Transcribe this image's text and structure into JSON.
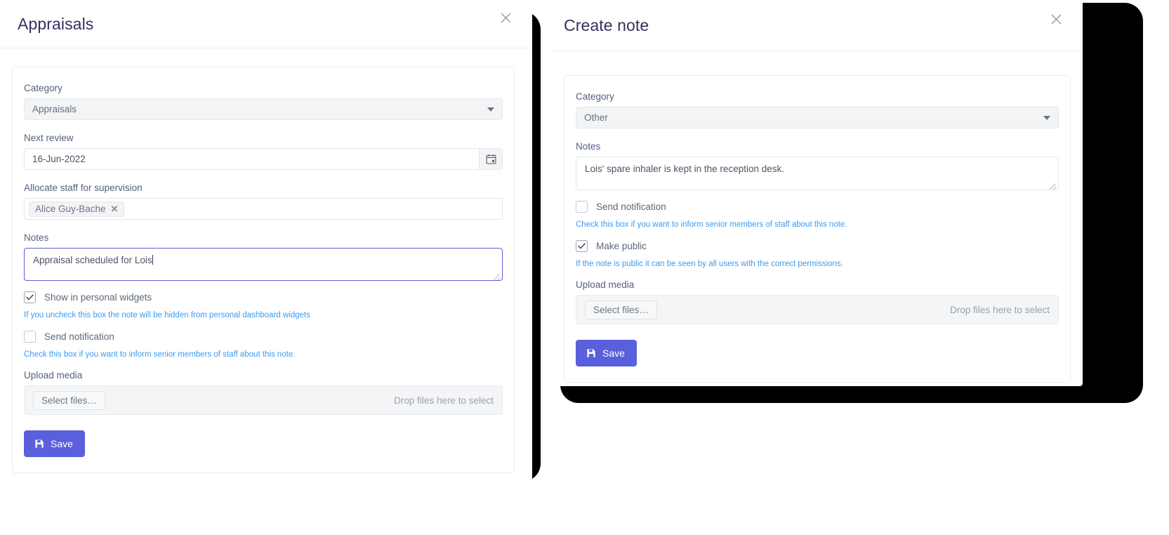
{
  "theme": {
    "accent": "#5a5fdc",
    "help_link": "#3b9bf0",
    "title_color": "#32325d",
    "label_color": "#525f7f",
    "shadow_plate": "#000000",
    "focus_border": "#5e60ce"
  },
  "left_dialog": {
    "title": "Appraisals",
    "close_icon": "close-icon",
    "fields": {
      "category_label": "Category",
      "category_value": "Appraisals",
      "next_review_label": "Next review",
      "next_review_value": "16-Jun-2022",
      "date_picker_icon": "calendar-icon",
      "allocate_label": "Allocate staff for supervision",
      "allocate_token": "Alice Guy-Bache",
      "allocate_token_remove": "✕",
      "notes_label": "Notes",
      "notes_value": "Appraisal scheduled for Lois"
    },
    "checkboxes": [
      {
        "label": "Show in personal widgets",
        "checked": true,
        "help": "If you uncheck this box the note will be hidden from personal dashboard widgets"
      },
      {
        "label": "Send notification",
        "checked": false,
        "help": "Check this box if you want to inform senior members of staff about this note."
      }
    ],
    "upload": {
      "label": "Upload media",
      "button": "Select files…",
      "hint": "Drop files here to select"
    },
    "save_label": "Save",
    "save_icon": "floppy-disk-icon"
  },
  "right_dialog": {
    "title": "Create note",
    "close_icon": "close-icon",
    "fields": {
      "category_label": "Category",
      "category_value": "Other",
      "notes_label": "Notes",
      "notes_value": "Lois' spare inhaler is kept in the reception desk."
    },
    "checkboxes": [
      {
        "label": "Send notification",
        "checked": false,
        "help": "Check this box if you want to inform senior members of staff about this note."
      },
      {
        "label": "Make public",
        "checked": true,
        "help": "If the note is public it can be seen by all users with the correct permissions."
      }
    ],
    "upload": {
      "label": "Upload media",
      "button": "Select files…",
      "hint": "Drop files here to select"
    },
    "save_label": "Save",
    "save_icon": "floppy-disk-icon"
  }
}
